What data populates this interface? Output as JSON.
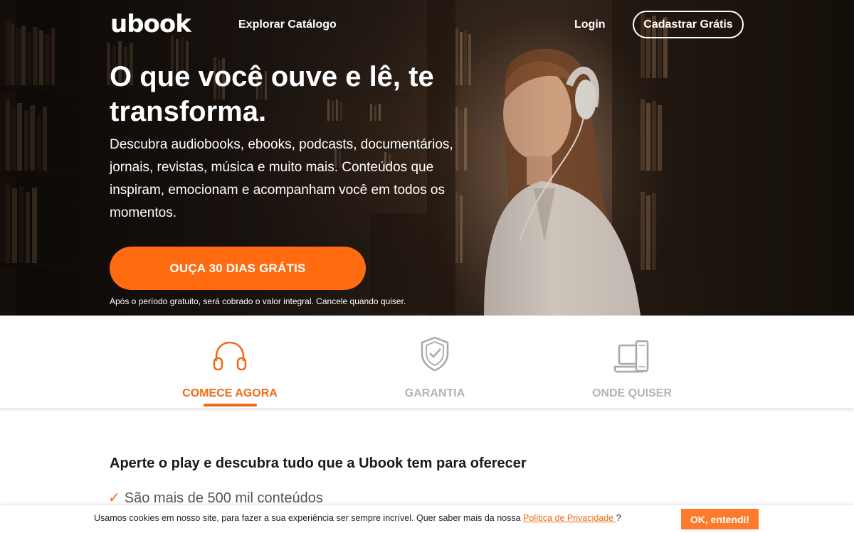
{
  "header": {
    "logo": "ubook",
    "nav_explore": "Explorar Catálogo",
    "nav_login": "Login",
    "signup_button": "Cadastrar Grátis"
  },
  "hero": {
    "title": "O que você ouve e lê, te transforma.",
    "description": "Descubra audiobooks, ebooks, podcasts, documentários, jornais, revistas, música e muito mais. Conteúdos que inspiram, emocionam e acompanham você em todos os momentos.",
    "cta_button": "OUÇA 30 DIAS GRÁTIS",
    "cta_note": "Após o período gratuito, será cobrado o valor integral. Cancele quando quiser."
  },
  "tabs": [
    {
      "label": "COMECE AGORA",
      "icon": "headphones-icon",
      "active": true
    },
    {
      "label": "GARANTIA",
      "icon": "shield-check-icon",
      "active": false
    },
    {
      "label": "ONDE QUISER",
      "icon": "devices-icon",
      "active": false
    }
  ],
  "content": {
    "section_title": "Aperte o play e descubra tudo que a Ubook tem para oferecer",
    "features": [
      {
        "check": "✓",
        "text": "São mais de 500 mil conteúdos"
      }
    ]
  },
  "cookie": {
    "text_before": "Usamos cookies em nosso site, para fazer a sua experiência ser sempre incrível. Quer saber mais da nossa ",
    "link": "Política de Privacidade ",
    "text_after": "?",
    "button": "OK, entendi!"
  },
  "colors": {
    "accent": "#ff6b10",
    "tab_active": "#ef6a14",
    "tab_inactive": "#b4b4b4"
  }
}
